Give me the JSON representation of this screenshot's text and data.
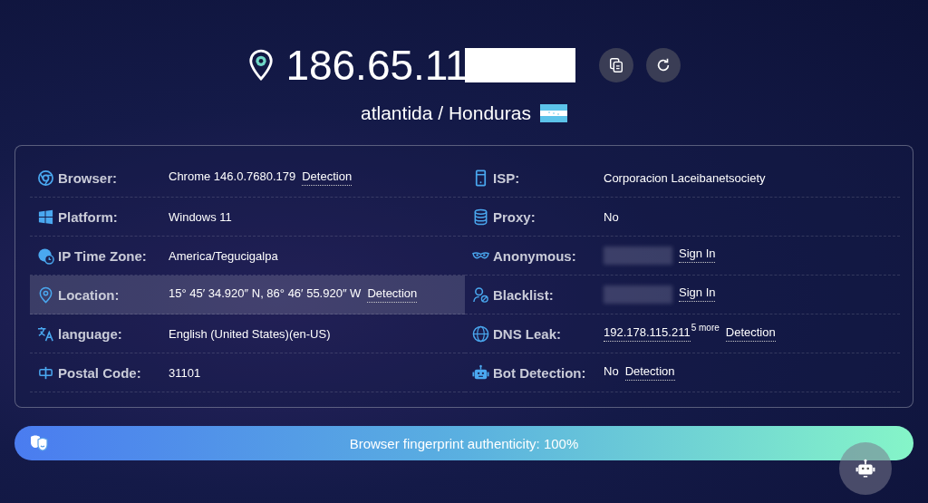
{
  "header": {
    "ip": "186.65.11",
    "ip_redacted": true,
    "location": "atlantida / Honduras"
  },
  "left_rows": [
    {
      "label": "Browser:",
      "highlighted": false,
      "parts": [
        {
          "kind": "text",
          "text": "Chrome 146.0.7680.179"
        },
        {
          "kind": "link",
          "text": "Detection"
        }
      ]
    },
    {
      "label": "Platform:",
      "highlighted": false,
      "parts": [
        {
          "kind": "text",
          "text": "Windows 11"
        }
      ]
    },
    {
      "label": "IP Time Zone:",
      "highlighted": false,
      "parts": [
        {
          "kind": "text",
          "text": "America/Tegucigalpa"
        }
      ]
    },
    {
      "label": "Location:",
      "highlighted": true,
      "parts": [
        {
          "kind": "text",
          "text": "15° 45′ 34.920″ N, 86° 46′ 55.920″ W"
        },
        {
          "kind": "link",
          "text": "Detection"
        }
      ]
    },
    {
      "label": "language:",
      "highlighted": false,
      "parts": [
        {
          "kind": "text",
          "text": "English (United States)(en-US)"
        }
      ]
    },
    {
      "label": "Postal Code:",
      "highlighted": false,
      "parts": [
        {
          "kind": "text",
          "text": "31101"
        }
      ]
    }
  ],
  "right_rows": [
    {
      "label": "ISP:",
      "highlighted": false,
      "parts": [
        {
          "kind": "text",
          "text": "Corporacion Laceibanetsociety"
        }
      ]
    },
    {
      "label": "Proxy:",
      "highlighted": false,
      "parts": [
        {
          "kind": "text",
          "text": "No"
        }
      ]
    },
    {
      "label": "Anonymous:",
      "highlighted": false,
      "parts": [
        {
          "kind": "redacted"
        },
        {
          "kind": "link",
          "text": "Sign In"
        }
      ]
    },
    {
      "label": "Blacklist:",
      "highlighted": false,
      "parts": [
        {
          "kind": "redacted"
        },
        {
          "kind": "link",
          "text": "Sign In"
        }
      ]
    },
    {
      "label": "DNS Leak:",
      "highlighted": false,
      "parts": [
        {
          "kind": "link",
          "text": "192.178.115.211"
        },
        {
          "kind": "sup",
          "text": "5 more"
        },
        {
          "kind": "link",
          "text": "Detection"
        }
      ]
    },
    {
      "label": "Bot Detection:",
      "highlighted": false,
      "parts": [
        {
          "kind": "text",
          "text": "No"
        },
        {
          "kind": "link",
          "text": "Detection"
        }
      ]
    }
  ],
  "authenticity": {
    "text": "Browser fingerprint authenticity: 100%"
  }
}
